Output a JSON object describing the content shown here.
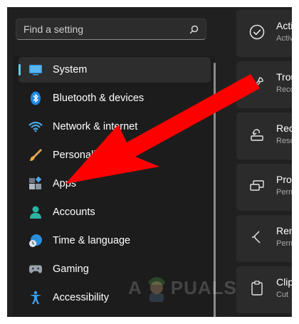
{
  "search": {
    "placeholder": "Find a setting"
  },
  "nav": {
    "items": [
      {
        "label": "System",
        "icon": "monitor-icon",
        "selected": true
      },
      {
        "label": "Bluetooth & devices",
        "icon": "bluetooth-icon"
      },
      {
        "label": "Network & internet",
        "icon": "wifi-icon"
      },
      {
        "label": "Personalization",
        "icon": "brush-icon"
      },
      {
        "label": "Apps",
        "icon": "apps-icon"
      },
      {
        "label": "Accounts",
        "icon": "person-icon"
      },
      {
        "label": "Time & language",
        "icon": "globe-clock-icon"
      },
      {
        "label": "Gaming",
        "icon": "gamepad-icon"
      },
      {
        "label": "Accessibility",
        "icon": "accessibility-icon"
      }
    ]
  },
  "cards": [
    {
      "title": "Acti",
      "sub": "Activ",
      "icon": "check-circle-icon"
    },
    {
      "title": "Trou",
      "sub": "Reco",
      "icon": "wrench-icon"
    },
    {
      "title": "Rec",
      "sub": "Rese",
      "icon": "recovery-icon"
    },
    {
      "title": "Pro",
      "sub": "Perm",
      "icon": "projector-icon"
    },
    {
      "title": "Ren",
      "sub": "Perm",
      "icon": "remote-icon"
    },
    {
      "title": "Clip",
      "sub": "Cut",
      "icon": "clipboard-icon"
    }
  ],
  "watermark": {
    "left": "A",
    "right": "PUALS"
  },
  "colors": {
    "accent": "#60cdff",
    "arrow": "#ff0000",
    "background": "#202020"
  }
}
